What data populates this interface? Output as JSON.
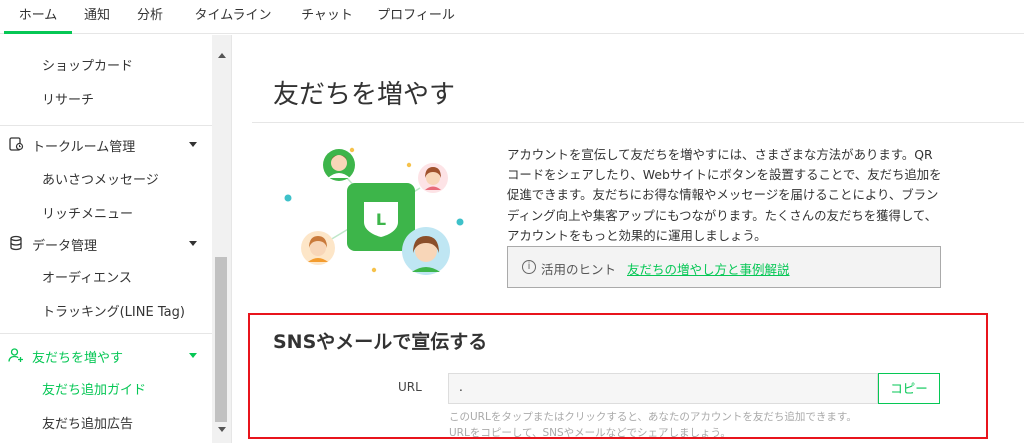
{
  "topnav": {
    "tabs": [
      "ホーム",
      "通知",
      "分析",
      "タイムライン",
      "チャット",
      "プロフィール"
    ]
  },
  "sidebar": {
    "items_shop": "ショップカード",
    "items_research": "リサーチ",
    "talk_room": {
      "label": "トークルーム管理",
      "items": [
        "あいさつメッセージ",
        "リッチメニュー"
      ]
    },
    "data_mgmt": {
      "label": "データ管理",
      "items": [
        "オーディエンス",
        "トラッキング(LINE Tag)"
      ]
    },
    "friends": {
      "label": "友だちを増やす",
      "items": [
        "友だち追加ガイド",
        "友だち追加広告"
      ]
    }
  },
  "main": {
    "title": "友だちを増やす",
    "description": "アカウントを宣伝して友だちを増やすには、さまざまな方法があります。QRコードをシェアしたり、Webサイトにボタンを設置することで、友だち追加を促進できます。友だちにお得な情報やメッセージを届けることにより、ブランディング向上や集客アップにもつながります。たくさんの友だちを獲得して、アカウントをもっと効果的に運用しましょう。",
    "hint_icon_glyph": "i",
    "hint_label": "活用のヒント",
    "hint_link": "友だちの増やし方と事例解説",
    "logo_letter": "L"
  },
  "sns": {
    "title": "SNSやメールで宣伝する",
    "url_label": "URL",
    "url_value": ".",
    "copy_label": "コピー",
    "helper_line1": "このURLをタップまたはクリックすると、あなたのアカウントを友だち追加できます。",
    "helper_line2": "URLをコピーして、SNSやメールなどでシェアしましょう。"
  },
  "colors": {
    "accent": "#06c755",
    "highlight_border": "#e8141c"
  }
}
